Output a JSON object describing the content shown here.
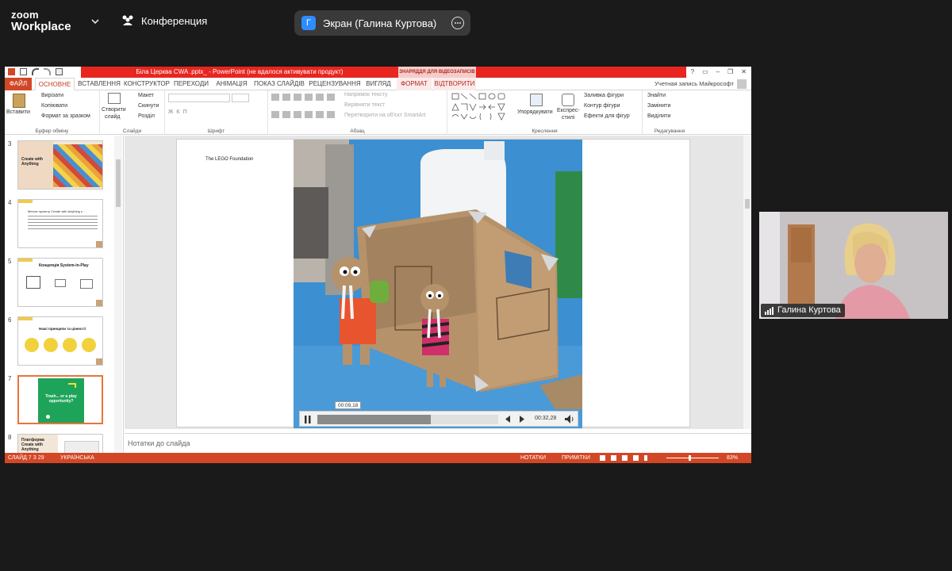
{
  "zoom": {
    "brand_line1": "zoom",
    "brand_line2": "Workplace",
    "meeting_label": "Конференция",
    "share_badge": "Г",
    "share_label": "Экран (Галина Куртова)"
  },
  "ppt": {
    "window_title": "Біла Церква CWA .pptx_ - PowerPoint (не вдалося активувати продукт)",
    "contextual_tab": "ЗНАРЯДДЯ ДЛЯ ВІДЕОЗАПИСІВ",
    "win_controls": [
      "?",
      "▭",
      "–",
      "❐",
      "✕"
    ],
    "tabs": [
      {
        "label": "ФАЙЛ"
      },
      {
        "label": "ОСНОВНЕ"
      },
      {
        "label": "ВСТАВЛЕННЯ"
      },
      {
        "label": "КОНСТРУКТОР"
      },
      {
        "label": "ПЕРЕХОДИ"
      },
      {
        "label": "АНІМАЦІЯ"
      },
      {
        "label": "ПОКАЗ СЛАЙДІВ"
      },
      {
        "label": "РЕЦЕНЗУВАННЯ"
      },
      {
        "label": "ВИГЛЯД"
      },
      {
        "label": "ФОРМАТ"
      },
      {
        "label": "ВІДТВОРИТИ"
      }
    ],
    "account": "Учетная запись Майкрософт",
    "ribbon": {
      "paste": "Вставити",
      "cut": "Вирізати",
      "copy": "Копіювати",
      "format_painter": "Формат за зразком",
      "clipboard_group": "Буфер обміну",
      "new_slide_1": "Створити",
      "new_slide_2": "слайд",
      "layout": "Макет",
      "reset": "Скинути",
      "sections": "Розділ",
      "slides_group": "Слайди",
      "font_group": "Шрифт",
      "text_direction": "Напрямок тексту",
      "align_text": "Вирівняти текст",
      "smartart": "Перетворити на об'єкт SmartArt",
      "paragraph_group": "Абзац",
      "arrange_1": "Упорядкувати",
      "quick_styles_1": "Експрес-",
      "quick_styles_2": "стилі",
      "shape_fill": "Заливка фігури",
      "shape_outline": "Контур фігури",
      "shape_effects": "Ефекти для фігур",
      "drawing_group": "Креслення",
      "find": "Знайти",
      "replace": "Замінити",
      "select": "Виділити",
      "editing_group": "Редагування"
    },
    "thumbnails": [
      {
        "num": "3",
        "title": "Create with Anything"
      },
      {
        "num": "4",
        "title": "Метою проекту Create with Anything є ..."
      },
      {
        "num": "5",
        "title": "Концепція System-in-Play"
      },
      {
        "num": "6",
        "title": "Наші принципи та цінності"
      },
      {
        "num": "7",
        "title": "Trash... or a play opportunity?"
      },
      {
        "num": "8",
        "title": "Платформа Create with Anything"
      }
    ],
    "slide": {
      "logo_text": "The LEGO Foundation",
      "video_tooltip": "00:09,18",
      "video_time": "00:32,28"
    },
    "notes_placeholder": "Нотатки до слайда",
    "status": {
      "slide_info": "СЛАЙД 7 З 29",
      "language": "УКРАЇНСЬКА",
      "notes": "НОТАТКИ",
      "comments": "ПРИМІТКИ",
      "zoom_level": "83%"
    }
  },
  "participant": {
    "name": "Галина Куртова"
  },
  "colors": {
    "zoom_bg": "#1a1a1a",
    "ppt_accent": "#d24726",
    "title_red": "#e8251f",
    "share_badge": "#2d8cff"
  }
}
